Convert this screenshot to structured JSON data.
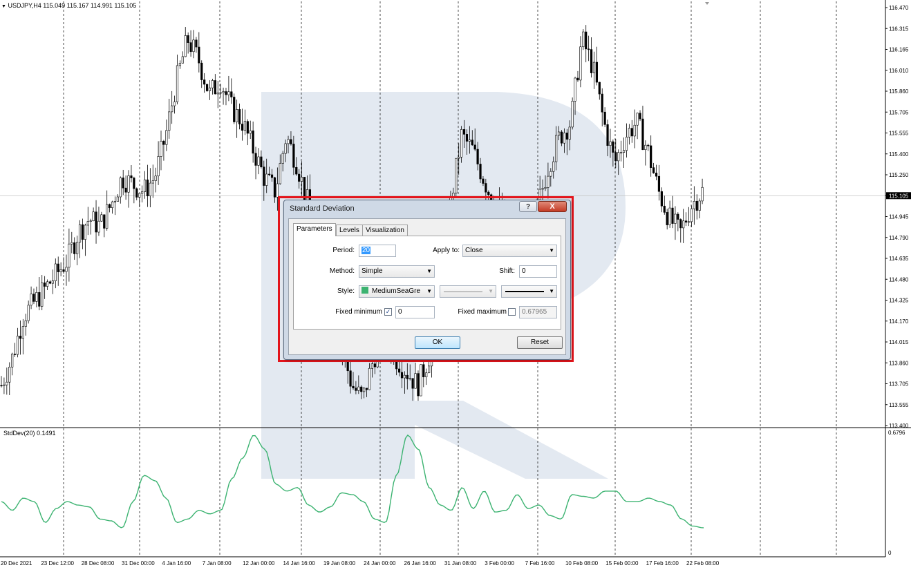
{
  "symbol_info": "USDJPY,H4  115.049 115.167 114.991 115.105",
  "indicator_label": "StdDev(20) 0.1491",
  "price_axis": [
    "116.470",
    "116.315",
    "116.165",
    "116.010",
    "115.860",
    "115.705",
    "115.555",
    "115.400",
    "115.250",
    "115.105",
    "114.945",
    "114.790",
    "114.635",
    "114.480",
    "114.325",
    "114.170",
    "114.015",
    "113.860",
    "113.705",
    "113.555",
    "113.400"
  ],
  "current_price": "115.105",
  "indicator_axis": [
    "0.6796",
    "0"
  ],
  "time_axis": [
    "20 Dec 2021",
    "23 Dec 12:00",
    "28 Dec 08:00",
    "31 Dec 00:00",
    "4 Jan 16:00",
    "7 Jan 08:00",
    "12 Jan 00:00",
    "14 Jan 16:00",
    "19 Jan 08:00",
    "24 Jan 00:00",
    "26 Jan 16:00",
    "31 Jan 08:00",
    "3 Feb 00:00",
    "7 Feb 16:00",
    "10 Feb 08:00",
    "15 Feb 00:00",
    "17 Feb 16:00",
    "22 Feb 08:00"
  ],
  "colors": {
    "candle": "#000000",
    "stddev_line": "#3cb371",
    "highlight": "#e3141b",
    "watermark": "#e3e9f1"
  },
  "chart_data": {
    "type": "line",
    "xlabel": "",
    "ylabel": "",
    "ylim": [
      113.4,
      116.47
    ],
    "price_close": [
      113.7,
      113.9,
      114.2,
      114.3,
      114.4,
      114.5,
      114.6,
      114.8,
      114.9,
      114.85,
      115.0,
      115.2,
      115.15,
      115.1,
      115.2,
      115.5,
      115.9,
      116.2,
      116.05,
      115.8,
      115.9,
      115.7,
      115.6,
      115.4,
      115.2,
      115.1,
      115.5,
      115.3,
      115.0,
      114.6,
      114.3,
      114.0,
      113.7,
      113.6,
      113.9,
      114.1,
      113.9,
      113.8,
      113.7,
      113.9,
      114.2,
      115.0,
      115.5,
      115.4,
      115.2,
      115.0,
      114.9,
      114.6,
      114.8,
      115.0,
      115.3,
      115.5,
      115.6,
      116.2,
      116.0,
      115.6,
      115.3,
      115.5,
      115.6,
      115.4,
      115.1,
      114.9,
      114.8,
      115.0,
      115.1
    ],
    "indicator": {
      "name": "StdDev(20)",
      "last_value": 0.1491,
      "ylim": [
        0,
        0.6796
      ],
      "values": [
        0.3,
        0.25,
        0.32,
        0.3,
        0.18,
        0.26,
        0.3,
        0.28,
        0.27,
        0.2,
        0.19,
        0.15,
        0.3,
        0.45,
        0.42,
        0.32,
        0.18,
        0.2,
        0.25,
        0.23,
        0.25,
        0.43,
        0.55,
        0.68,
        0.6,
        0.4,
        0.36,
        0.38,
        0.28,
        0.24,
        0.27,
        0.35,
        0.34,
        0.3,
        0.2,
        0.18,
        0.45,
        0.68,
        0.6,
        0.38,
        0.28,
        0.25,
        0.38,
        0.26,
        0.36,
        0.24,
        0.25,
        0.34,
        0.26,
        0.28,
        0.22,
        0.2,
        0.34,
        0.33,
        0.32,
        0.36,
        0.36,
        0.3,
        0.3,
        0.32,
        0.3,
        0.28,
        0.2,
        0.16,
        0.15
      ]
    }
  },
  "dialog": {
    "title": "Standard Deviation",
    "help": "?",
    "close": "X",
    "tabs": [
      "Parameters",
      "Levels",
      "Visualization"
    ],
    "period_label": "Period:",
    "period_value": "20",
    "apply_label": "Apply to:",
    "apply_value": "Close",
    "method_label": "Method:",
    "method_value": "Simple",
    "shift_label": "Shift:",
    "shift_value": "0",
    "style_label": "Style:",
    "color_value": "MediumSeaGre",
    "fixed_min_label": "Fixed minimum",
    "fixed_min_value": "0",
    "fixed_max_label": "Fixed maximum",
    "fixed_max_value": "0.67965",
    "ok_label": "OK",
    "reset_label": "Reset"
  }
}
